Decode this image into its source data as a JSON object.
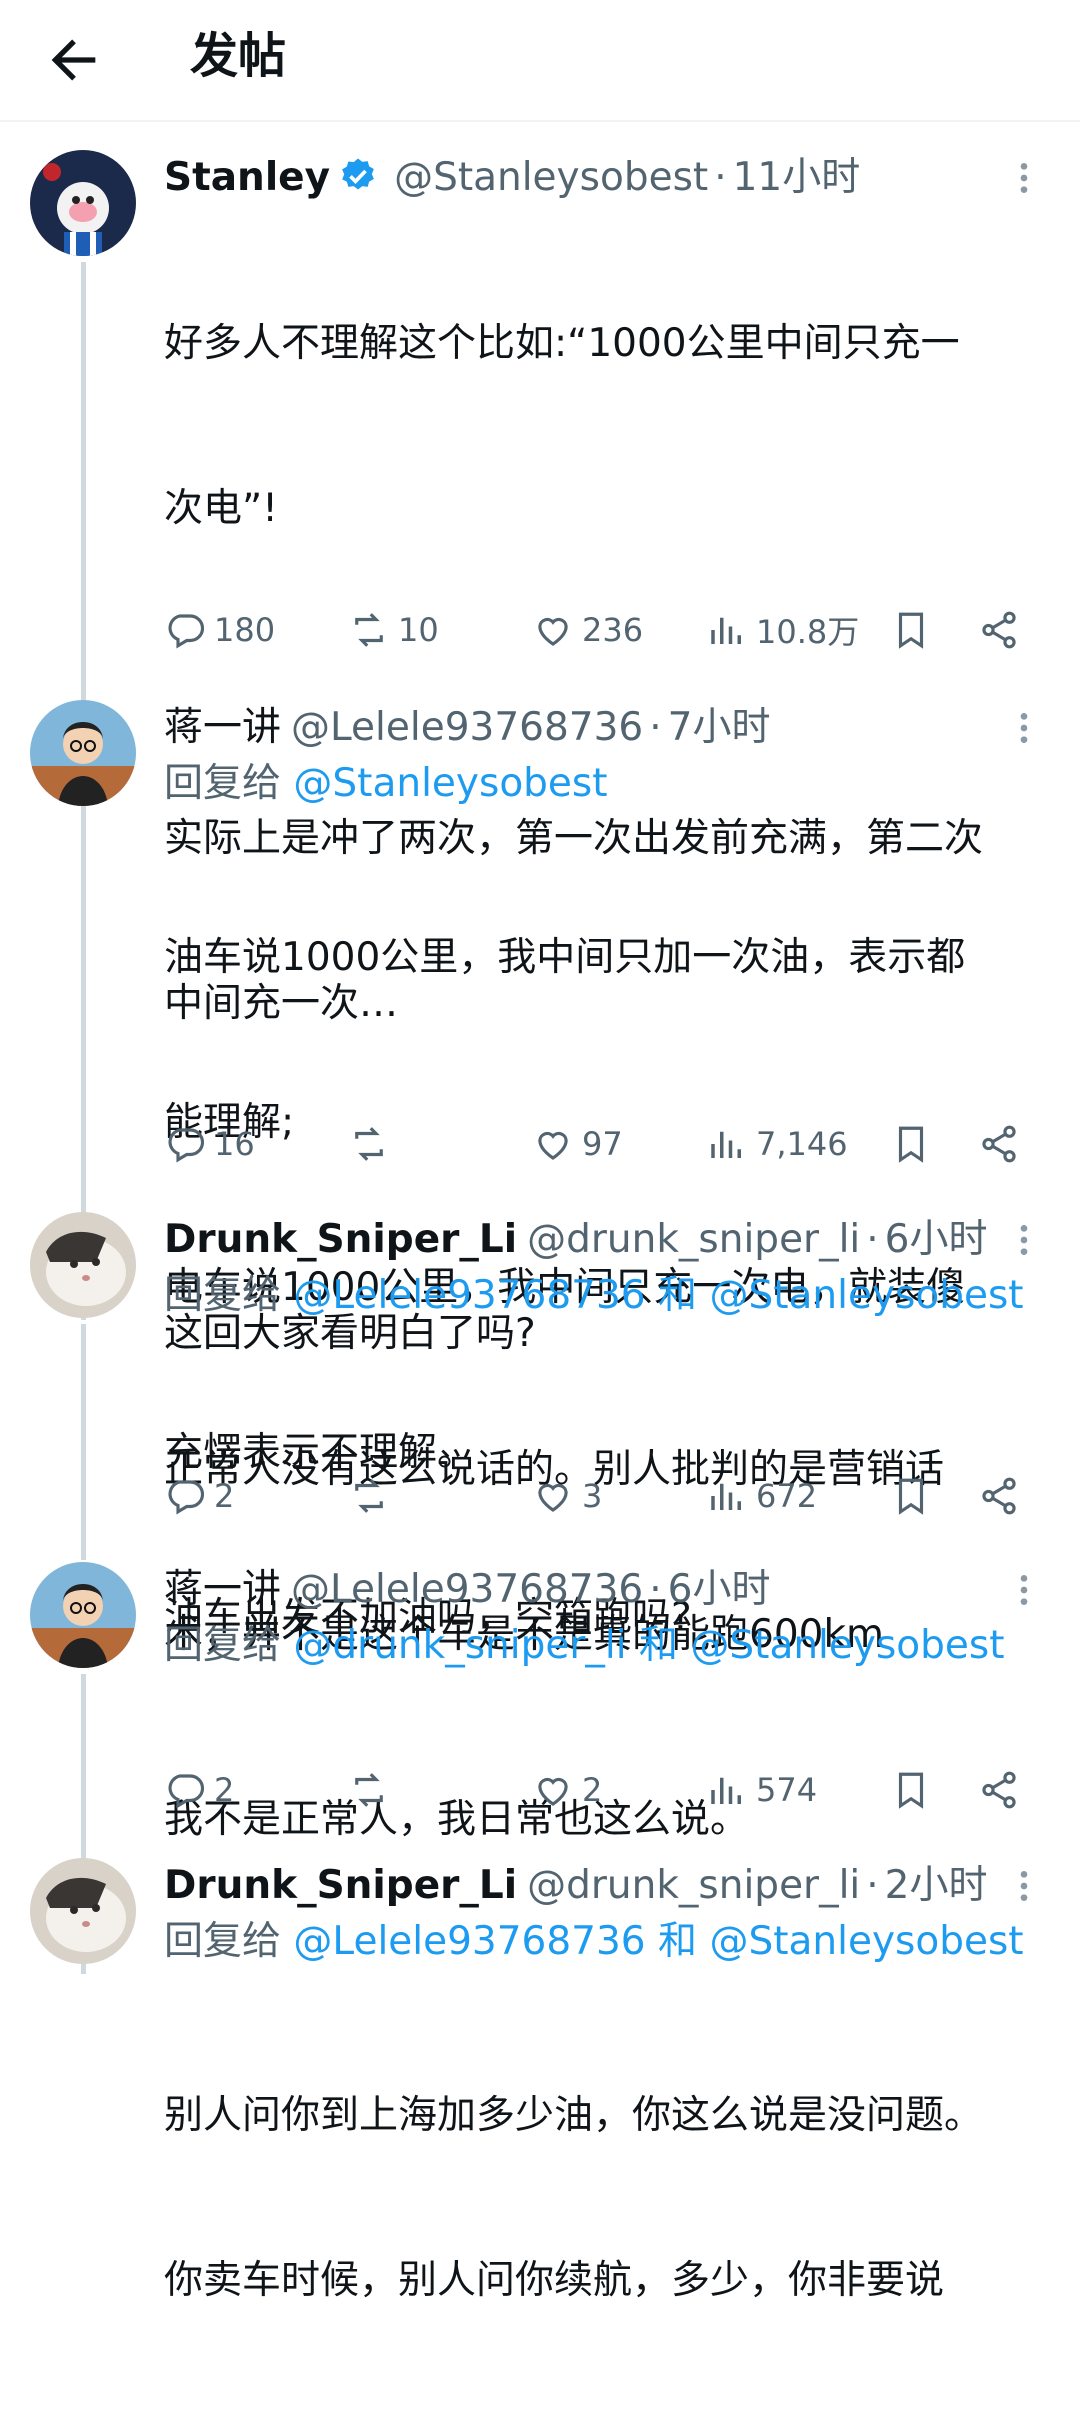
{
  "header": {
    "title": "发帖"
  },
  "posts": [
    {
      "name": "Stanley",
      "handle": "@Stanleysobest",
      "time": "11小时",
      "verified": true,
      "lines": [
        "好多人不理解这个比如:“1000公里中间只充一",
        "次电”!",
        "",
        "实际上是冲了两次，第一次出发前充满，第二次",
        "中间充一次…",
        "",
        "这回大家看明白了吗?"
      ],
      "stats": {
        "replies": "180",
        "reposts": "10",
        "likes": "236",
        "views": "10.8万"
      }
    },
    {
      "name": "蒋一讲",
      "handle": "@Lelele93768736",
      "time": "7小时",
      "reply_prefix": "回复给",
      "reply_mentions": [
        "@Stanleysobest"
      ],
      "lines": [
        "油车说1000公里，我中间只加一次油，表示都",
        "能理解;",
        "电车说1000公里，我中间只充一次电，就装傻",
        "充愣表示不理解。",
        "油车出发不加油吗，空箱跑吗?"
      ],
      "stats": {
        "replies": "16",
        "reposts": "",
        "likes": "97",
        "views": "7,146"
      }
    },
    {
      "name": "Drunk_Sniper_Li",
      "handle": "@drunk_sniper_li",
      "time": "6小时",
      "reply_prefix": "回复给",
      "reply_mentions": [
        "@Lelele93768736",
        "@Stanleysobest"
      ],
      "reply_joiner": "和",
      "lines": [
        "正常人没有这么说话的。别人批判的是营销话",
        "术，并不是这个车是不是真的能跑600km"
      ],
      "stats": {
        "replies": "2",
        "reposts": "",
        "likes": "3",
        "views": "672"
      }
    },
    {
      "name": "蒋一讲",
      "handle": "@Lelele93768736",
      "time": "6小时",
      "reply_prefix": "回复给",
      "reply_mentions": [
        "@drunk_sniper_li",
        "@Stanleysobest"
      ],
      "reply_joiner": "和",
      "lines": [
        "我不是正常人，我日常也这么说。"
      ],
      "stats": {
        "replies": "2",
        "reposts": "",
        "likes": "2",
        "views": "574"
      }
    },
    {
      "name": "Drunk_Sniper_Li",
      "handle": "@drunk_sniper_li",
      "time": "2小时",
      "reply_prefix": "回复给",
      "reply_mentions": [
        "@Lelele93768736",
        "@Stanleysobest"
      ],
      "reply_joiner": "和",
      "lines": [
        "别人问你到上海加多少油，你这么说是没问题。",
        "你卖车时候，别人问你续航，多少，你非要说"
      ]
    }
  ],
  "icons": {
    "back": "arrow-left-icon",
    "more": "more-vertical-icon",
    "reply": "speech-bubble-icon",
    "repost": "repost-arrows-icon",
    "like": "heart-icon",
    "views": "bar-chart-icon",
    "bookmark": "bookmark-icon",
    "share": "share-icon",
    "verified": "verified-badge-icon"
  },
  "colors": {
    "accent": "#1d9bf0",
    "muted": "#536471",
    "text": "#0f1419",
    "thread_line": "#cfd9de"
  }
}
